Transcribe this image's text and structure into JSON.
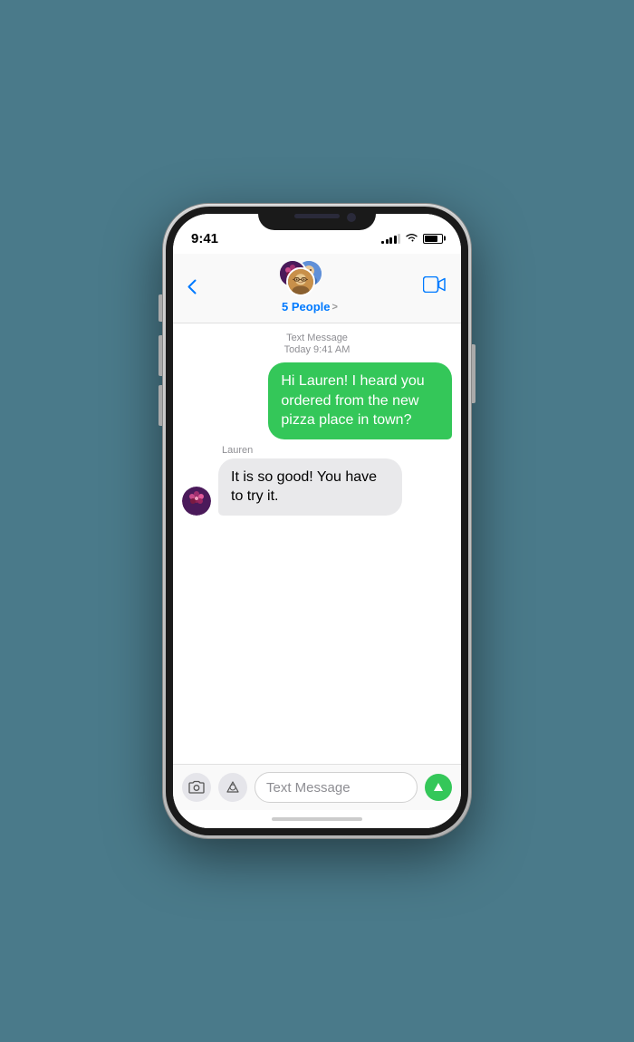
{
  "statusBar": {
    "time": "9:41",
    "signalBars": [
      3,
      5,
      7,
      9,
      11
    ],
    "batteryPercent": 80
  },
  "header": {
    "backLabel": "",
    "groupName": "5 People",
    "groupChevron": ">",
    "videoIcon": "video-camera"
  },
  "messageMeta": {
    "service": "Text Message",
    "timestamp": "Today 9:41 AM"
  },
  "messages": [
    {
      "id": "msg1",
      "type": "sent",
      "text": "Hi Lauren! I heard you ordered from the new pizza place in town?",
      "senderName": null
    },
    {
      "id": "msg2",
      "type": "received",
      "text": "It is so good! You have to try it.",
      "senderName": "Lauren"
    }
  ],
  "inputBar": {
    "cameraIcon": "camera",
    "appStoreIcon": "app-store",
    "placeholder": "Text Message",
    "sendIcon": "send-arrow"
  }
}
